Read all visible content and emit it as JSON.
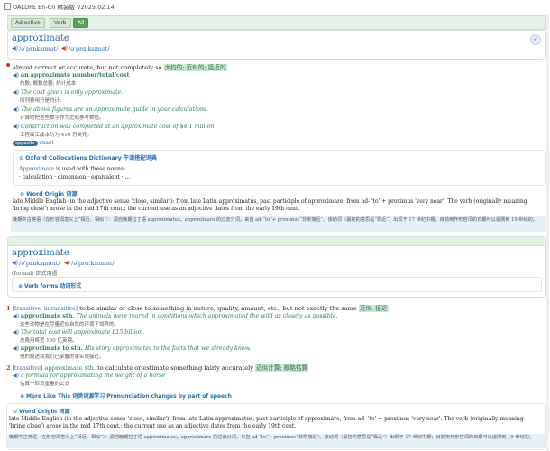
{
  "window": {
    "title": "OALDPE En-Cn 精装版 V2025.02.14"
  },
  "filters": [
    "Adjective",
    "Verb",
    "All"
  ],
  "adj": {
    "headword": "approximate",
    "pos": "adj",
    "pron_br": "/əˈprɒksɪmət/",
    "pron_us": "/əˈprɑːksɪmət/",
    "def": "almost correct or accurate, but not completely so",
    "def_cn": "大约的; 近似的; 接近的",
    "ex1_phrase": "an approximate number/total/cost",
    "ex1_cn": "约数; 概数总额; 约计成本",
    "ex2": "The cost given is only approximate.",
    "ex2_cn": "所列费用只是约计。",
    "ex3": "The above figures are an approximate guide in your calculations.",
    "ex3_cn": "计算时把这些数字作为近似参考数值。",
    "ex4": "Construction was completed at an approximate cost of $4.1 million.",
    "ex4_cn": "工程竣工成本约为 410 万美元。",
    "opp_label": "opposite",
    "opp_word": "exact",
    "colloc_title": "Oxford Collocations Dictionary 牛津搭配词典",
    "colloc_intro_word": "Approximate",
    "colloc_intro_rest": "is used with these nouns:",
    "colloc_list": "· calculation · dimension · equivalent · ...",
    "origin_title": "Word Origin 词源",
    "origin_text": "late Middle English (in the adjective sense 'close, similar'): from late Latin approximatus, past participle of approximare, from ad- 'to' + proximus 'very near'. The verb (originally meaning 'bring close') arose in the mid 17th cent.; the current use as an adjective dates from the early 19th cent.",
    "origin_cn": "晚期中古英语（在形容词意义上“相近，相似”）：源自晚期拉丁语 approximatus，approximare 的过去分词，来自 ad-“to”+ proximus“非常接近”。该动词（最初的意思是“靠近”）出现于 17 世纪中期；目前用作形容词的日期可以追溯到 19 世纪初。"
  },
  "verb": {
    "headword": "approximate",
    "pos": "v",
    "pron_br": "/əˈprɒksɪmeɪt/",
    "pron_us": "/əˈprɑːksɪmeɪt/",
    "register": "(formal) 正式用语",
    "forms_label": "Verb forms 动词形式",
    "sense1_num": "1",
    "sense1_gram": "[transitive, intransitive]",
    "sense1_def": "to be similar or close to something in nature, quality, amount, etc., but not exactly the same",
    "sense1_cn": "近似; 接近",
    "s1_ex1_pat": "approximate sth.",
    "s1_ex1": "The animals were reared in conditions which approximated the wild as closely as possible.",
    "s1_ex1_cn": "这些动物是在尽量近似自然的环境下饲养的。",
    "s1_ex2": "The total cost will approximate £15 billion.",
    "s1_ex2_cn": "总费用将近 150 亿英镑。",
    "s1_ex3_pat": "approximate to sth.",
    "s1_ex3": "His story approximates to the facts that we already know.",
    "s1_ex3_cn": "他的叙述和我们已掌握的事实很接近。",
    "sense2_num": "2",
    "sense2_gram": "[transitive]",
    "sense2_pat": "approximate sth.",
    "sense2_def": "to calculate or estimate something fairly accurately",
    "sense2_cn": "近似计算; 概略估算",
    "s2_ex1": "a formula for approximating the weight of a horse",
    "s2_ex1_cn": "估算一匹马重量的公式",
    "more_like": "More Like This 词类词源学习 Pronunciation changes by part of speech",
    "origin_title": "Word Origin 词源",
    "origin_text": "late Middle English (in the adjective sense 'close, similar'): from late Latin approximatus, past participle of approximare, from ad- 'to' + proximus 'very near'. The verb (originally meaning 'bring close') arose in the mid 17th cent.; the current use as an adjective dates from the early 19th cent.",
    "origin_cn": "晚期中古英语（在形容词意义上“相近，相似”）：源自晚期拉丁语 approximatus，approximare 的过去分词，来自 ad-“to”+ proximus“非常接近”。该动词（最初的意思是“靠近”）出现于 17 世纪中期；目前用作形容词的日期可以追溯到 19 世纪初。"
  },
  "colors": {
    "accent_green": "#5aa05a",
    "link_blue": "#2a6db0",
    "example_teal": "#2e7d5b",
    "red_bullet": "#c0392b"
  }
}
